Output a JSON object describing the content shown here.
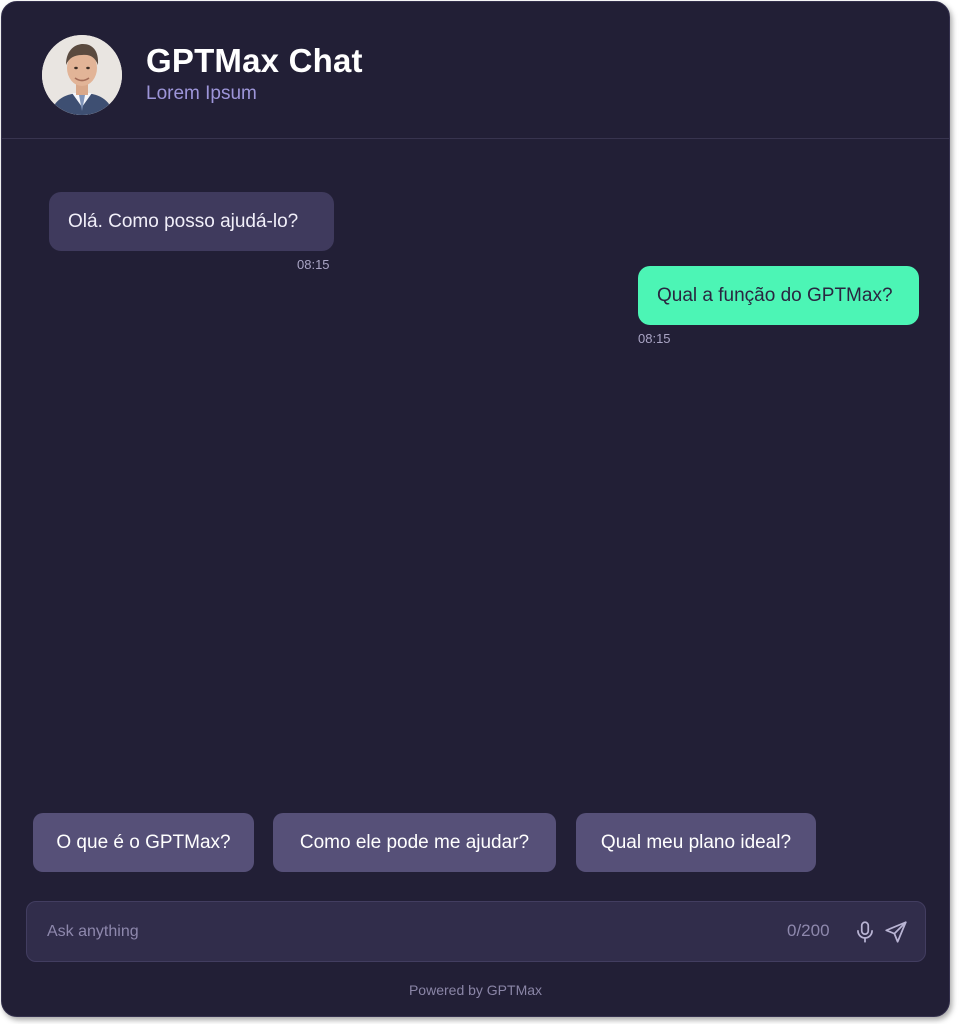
{
  "header": {
    "title": "GPTMax Chat",
    "subtitle": "Lorem Ipsum",
    "avatar_icon": "person-avatar-icon"
  },
  "messages": [
    {
      "sender": "bot",
      "text": "Olá. Como posso ajudá-lo?",
      "time": "08:15"
    },
    {
      "sender": "user",
      "text": "Qual a função do GPTMax?",
      "time": "08:15"
    }
  ],
  "suggestions": [
    "O que é o GPTMax?",
    "Como ele pode me ajudar?",
    "Qual meu plano ideal?"
  ],
  "input": {
    "placeholder": "Ask anything",
    "value": "",
    "counter": "0/200",
    "mic_icon": "microphone-icon",
    "send_icon": "send-icon"
  },
  "footer": {
    "text": "Powered by GPTMax"
  },
  "colors": {
    "background": "#221f36",
    "bot_bubble": "#3f3a5d",
    "user_bubble": "#4cf5b5",
    "suggestion": "#565078",
    "subtitle": "#9d95d9"
  }
}
